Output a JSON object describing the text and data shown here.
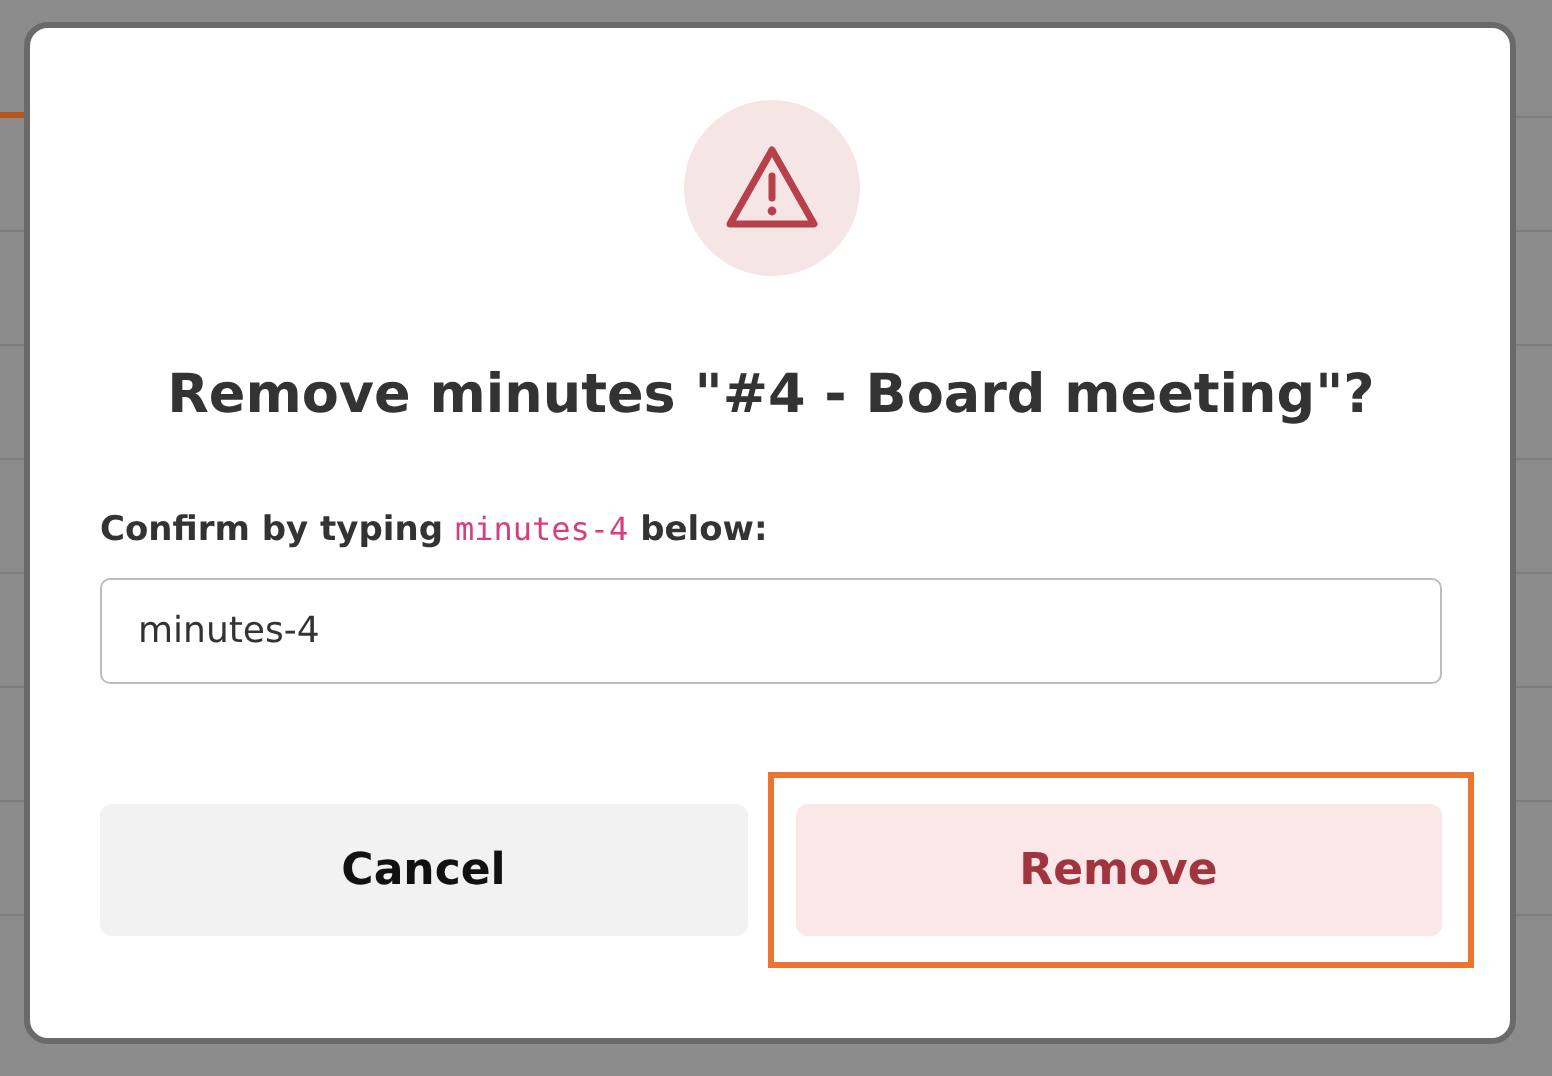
{
  "dialog": {
    "title": "Remove minutes \"#4 - Board meeting\"?",
    "prompt_before": "Confirm by typing",
    "confirm_code": "minutes-4",
    "prompt_after": "below:",
    "input": {
      "value": "minutes-4"
    },
    "buttons": [
      {
        "label": "Cancel",
        "kind": "secondary",
        "highlighted": false
      },
      {
        "label": "Remove",
        "kind": "danger",
        "highlighted": true
      }
    ]
  }
}
